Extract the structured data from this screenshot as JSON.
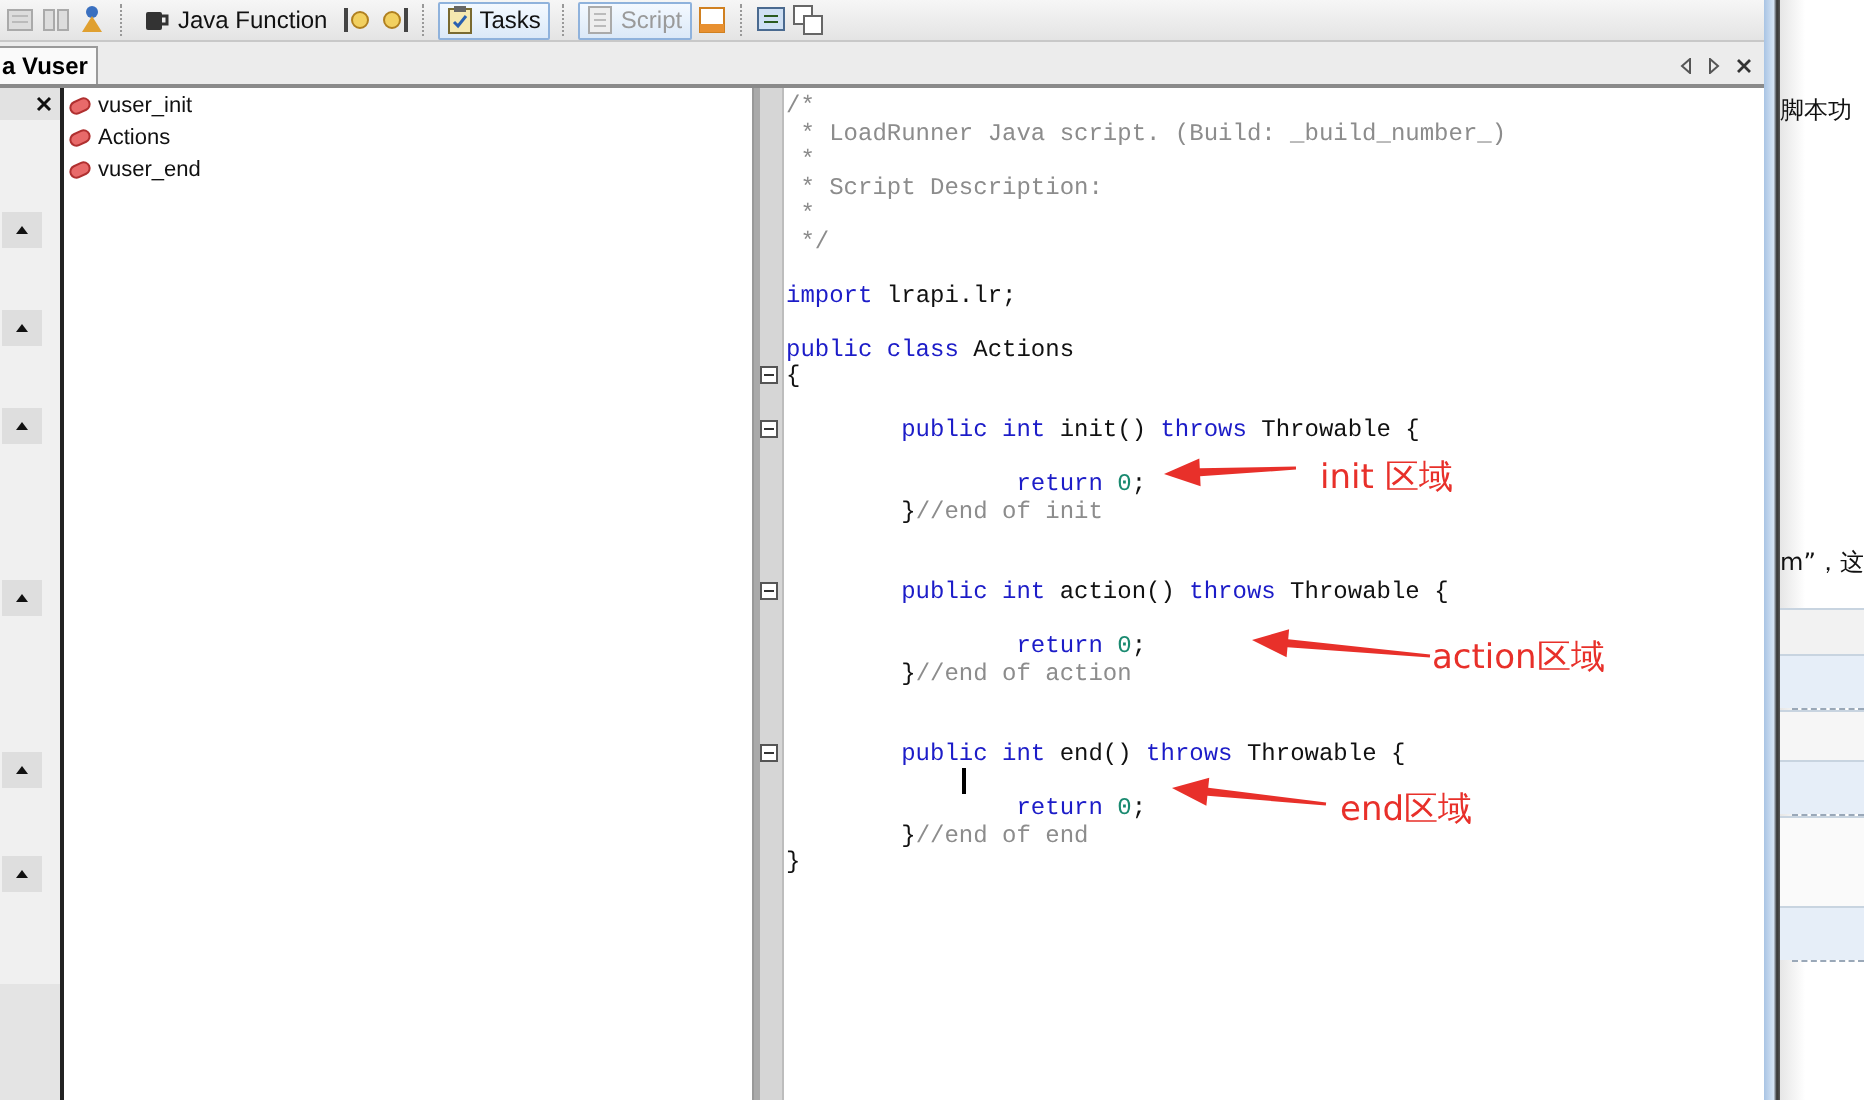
{
  "toolbar": {
    "buttons": [
      {
        "label": "Java Function",
        "selected": false,
        "disabled": false
      },
      {
        "label": "Tasks",
        "selected": true,
        "disabled": false
      },
      {
        "label": "Script",
        "selected": true,
        "disabled": true
      }
    ]
  },
  "tab_bar": {
    "tabs": [
      {
        "label": "a Vuser",
        "selected": true
      }
    ]
  },
  "tree": {
    "items": [
      {
        "label": "vuser_init"
      },
      {
        "label": "Actions"
      },
      {
        "label": "vuser_end"
      }
    ]
  },
  "editor": {
    "lines": [
      {
        "kind": "code",
        "fold": false,
        "tokens": [
          {
            "kind": "comment",
            "text": "/*"
          }
        ]
      },
      {
        "kind": "code",
        "fold": false,
        "tokens": [
          {
            "kind": "comment",
            "text": " * LoadRunner Java script. (Build: _build_number_)"
          }
        ]
      },
      {
        "kind": "code",
        "fold": false,
        "tokens": [
          {
            "kind": "comment",
            "text": " *"
          }
        ]
      },
      {
        "kind": "code",
        "fold": false,
        "tokens": [
          {
            "kind": "comment",
            "text": " * Script Description:"
          }
        ]
      },
      {
        "kind": "code",
        "fold": false,
        "tokens": [
          {
            "kind": "comment",
            "text": " *"
          }
        ]
      },
      {
        "kind": "code",
        "fold": false,
        "tokens": [
          {
            "kind": "comment",
            "text": " */"
          }
        ]
      },
      {
        "kind": "blank"
      },
      {
        "kind": "code",
        "fold": false,
        "tokens": [
          {
            "kind": "keyword",
            "text": "import"
          },
          {
            "kind": "plain",
            "text": " lrapi.lr;"
          }
        ]
      },
      {
        "kind": "blank"
      },
      {
        "kind": "code",
        "fold": false,
        "tokens": [
          {
            "kind": "keyword",
            "text": "public class"
          },
          {
            "kind": "plain",
            "text": " Actions"
          }
        ]
      },
      {
        "kind": "code",
        "fold": true,
        "tokens": [
          {
            "kind": "plain",
            "text": "{"
          }
        ]
      },
      {
        "kind": "blank"
      },
      {
        "kind": "code",
        "fold": true,
        "tokens": [
          {
            "kind": "keyword",
            "text": "        public int"
          },
          {
            "kind": "plain",
            "text": " init() "
          },
          {
            "kind": "keyword",
            "text": "throws"
          },
          {
            "kind": "plain",
            "text": " Throwable {"
          }
        ]
      },
      {
        "kind": "blank"
      },
      {
        "kind": "code",
        "fold": false,
        "tokens": [
          {
            "kind": "keyword",
            "text": "                return"
          },
          {
            "kind": "number",
            "text": " 0"
          },
          {
            "kind": "plain",
            "text": ";"
          }
        ]
      },
      {
        "kind": "code",
        "fold": false,
        "tokens": [
          {
            "kind": "plain",
            "text": "        }"
          },
          {
            "kind": "comment",
            "text": "//end of init"
          }
        ]
      },
      {
        "kind": "blank"
      },
      {
        "kind": "blank"
      },
      {
        "kind": "code",
        "fold": true,
        "tokens": [
          {
            "kind": "keyword",
            "text": "        public int"
          },
          {
            "kind": "plain",
            "text": " action() "
          },
          {
            "kind": "keyword",
            "text": "throws"
          },
          {
            "kind": "plain",
            "text": " Throwable {"
          }
        ]
      },
      {
        "kind": "blank"
      },
      {
        "kind": "code",
        "fold": false,
        "tokens": [
          {
            "kind": "keyword",
            "text": "                return"
          },
          {
            "kind": "number",
            "text": " 0"
          },
          {
            "kind": "plain",
            "text": ";"
          }
        ]
      },
      {
        "kind": "code",
        "fold": false,
        "tokens": [
          {
            "kind": "plain",
            "text": "        }"
          },
          {
            "kind": "comment",
            "text": "//end of action"
          }
        ]
      },
      {
        "kind": "blank"
      },
      {
        "kind": "blank"
      },
      {
        "kind": "code",
        "fold": true,
        "tokens": [
          {
            "kind": "keyword",
            "text": "        public int"
          },
          {
            "kind": "plain",
            "text": " end() "
          },
          {
            "kind": "keyword",
            "text": "throws"
          },
          {
            "kind": "plain",
            "text": " Throwable {"
          }
        ]
      },
      {
        "kind": "cursor"
      },
      {
        "kind": "code",
        "fold": false,
        "tokens": [
          {
            "kind": "keyword",
            "text": "                return"
          },
          {
            "kind": "number",
            "text": " 0"
          },
          {
            "kind": "plain",
            "text": ";"
          }
        ]
      },
      {
        "kind": "code",
        "fold": false,
        "tokens": [
          {
            "kind": "plain",
            "text": "        }"
          },
          {
            "kind": "comment",
            "text": "//end of end"
          }
        ]
      },
      {
        "kind": "code",
        "fold": false,
        "tokens": [
          {
            "kind": "plain",
            "text": "}"
          }
        ]
      }
    ]
  },
  "annotations": [
    {
      "label": "init 区域"
    },
    {
      "label": "action区域"
    },
    {
      "label": "end区域"
    }
  ],
  "background_page": {
    "texts": [
      "脚本功",
      "m”，这"
    ]
  }
}
